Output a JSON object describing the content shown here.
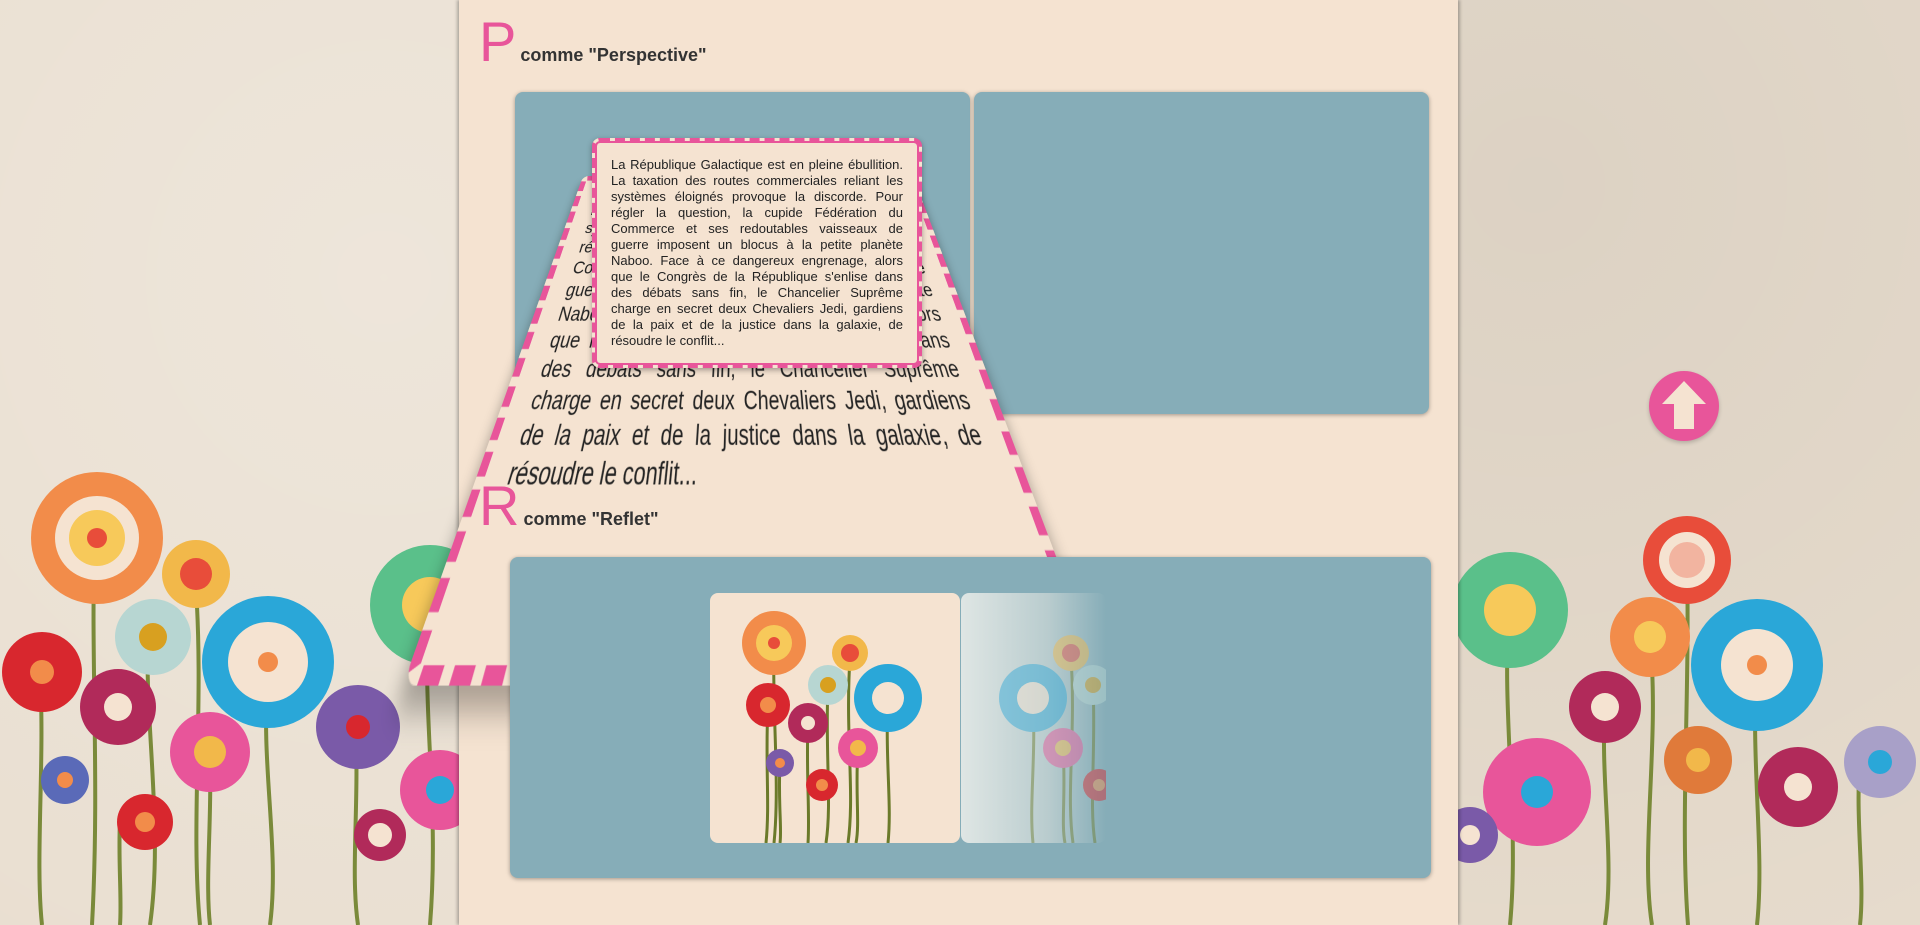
{
  "sections": {
    "perspective": {
      "letter": "P",
      "title": "comme \"Perspective\""
    },
    "reflet": {
      "letter": "R",
      "title": "comme \"Reflet\""
    }
  },
  "card_text": "La République Galactique est en pleine ébullition. La taxation des routes commerciales reliant les systèmes éloignés provoque la discorde. Pour régler la question, la cupide Fédération du Commerce et ses redoutables vaisseaux de guerre imposent un blocus à la petite planète Naboo. Face à ce dangereux engrenage, alors que le Congrès de la République s'enlise dans des débats sans fin, le Chancelier Suprême charge en secret deux Chevaliers Jedi, gardiens de la paix et de la justice dans la galaxie, de résoudre le conflit...",
  "icons": {
    "scroll_top": "arrow-up-icon"
  },
  "colors": {
    "accent": "#e8559a",
    "panel": "#86adb8",
    "card": "#f5e3d1"
  }
}
